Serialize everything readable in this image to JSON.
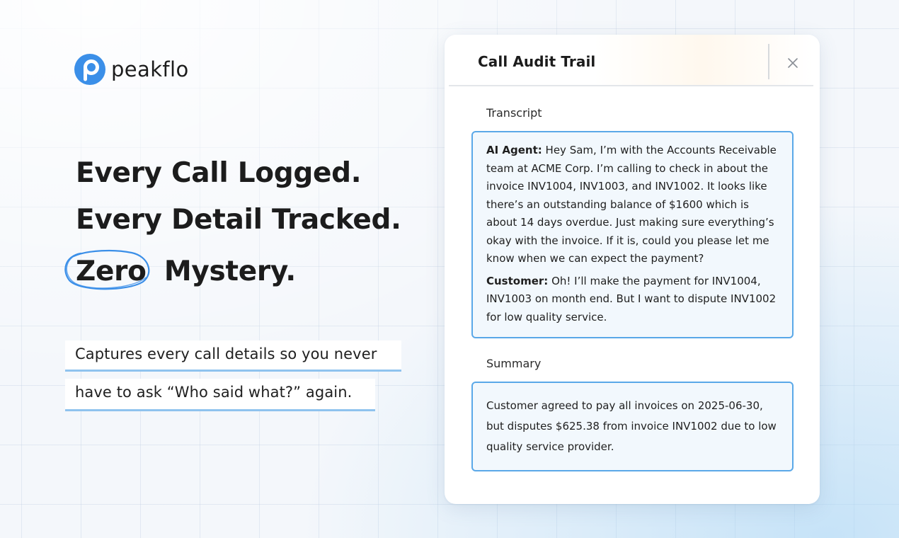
{
  "brand": {
    "name": "peakflo",
    "logo_icon": "peakflo-logo-icon",
    "color": "#3b8fe8"
  },
  "headline": {
    "line1": "Every Call Logged.",
    "line2": "Every Detail Tracked.",
    "line3_circled": "Zero",
    "line3_rest": "Mystery."
  },
  "subtext": {
    "line1": "Captures every call details so you never",
    "line2": "have to ask “Who said what?” again."
  },
  "panel": {
    "title": "Call Audit Trail",
    "close_icon": "close-icon",
    "transcript_label": "Transcript",
    "transcript": [
      {
        "speaker": "AI Agent:",
        "text": " Hey Sam, I’m with the Accounts Receivable team at ACME Corp. I’m calling to check in about the invoice INV1004, INV1003, and INV1002. It looks like there’s an outstanding balance of $1600 which is about 14 days overdue. Just making sure everything’s okay with the invoice. If it is, could you please let me know when we can expect the payment?"
      },
      {
        "speaker": "Customer:",
        "text": " Oh! I’ll make the payment for INV1004, INV1003 on month end. But I want to dispute INV1002 for low quality service."
      }
    ],
    "summary_label": "Summary",
    "summary": "Customer agreed to pay all invoices on 2025-06-30, but disputes $625.38 from invoice INV1002 due to low quality service provider."
  },
  "colors": {
    "accent": "#5aa8e8",
    "box_fill": "#f2f8fd",
    "underline": "#8fc3ee",
    "text": "#1c1c1c"
  }
}
